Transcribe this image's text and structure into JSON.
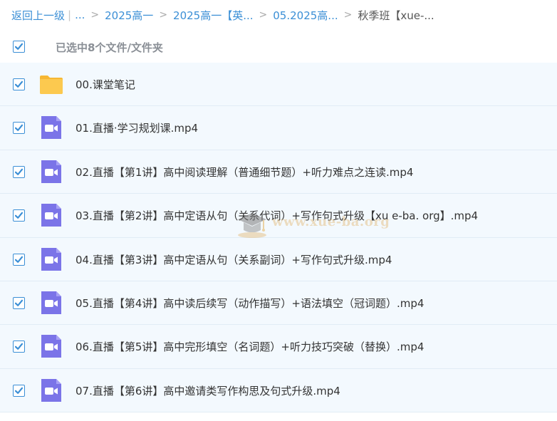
{
  "breadcrumb": {
    "back": "返回上一级",
    "pipe": "|",
    "ellipsis": "...",
    "sep": ">",
    "items": [
      "2025高一",
      "2025高一【英...",
      "05.2025高...",
      "秋季班【xue-..."
    ]
  },
  "selection": {
    "summary": "已选中8个文件/文件夹",
    "checked": true
  },
  "files": [
    {
      "name": "00.课堂笔记",
      "type": "folder",
      "checked": true
    },
    {
      "name": "01.直播·学习规划课.mp4",
      "type": "video",
      "checked": true
    },
    {
      "name": "02.直播【第1讲】高中阅读理解（普通细节题）+听力难点之连读.mp4",
      "type": "video",
      "checked": true
    },
    {
      "name": "03.直播【第2讲】高中定语从句（关系代词）+写作句式升级【xu e-ba. org】.mp4",
      "type": "video",
      "checked": true
    },
    {
      "name": "04.直播【第3讲】高中定语从句（关系副词）+写作句式升级.mp4",
      "type": "video",
      "checked": true
    },
    {
      "name": "05.直播【第4讲】高中读后续写（动作描写）+语法填空（冠词题）.mp4",
      "type": "video",
      "checked": true
    },
    {
      "name": "06.直播【第5讲】高中完形填空（名词题）+听力技巧突破（替换）.mp4",
      "type": "video",
      "checked": true
    },
    {
      "name": "07.直播【第6讲】高中邀请类写作构思及句式升级.mp4",
      "type": "video",
      "checked": true
    }
  ],
  "watermark": {
    "text": "www.xue-ba.org"
  },
  "colors": {
    "accent": "#3b8fd6",
    "row_bg": "#f3f9fe",
    "folder": "#fcc94f",
    "video": "#7b74e8"
  },
  "icons": {
    "folder": "folder-icon",
    "video": "video-file-icon",
    "check": "checkmark-icon"
  }
}
